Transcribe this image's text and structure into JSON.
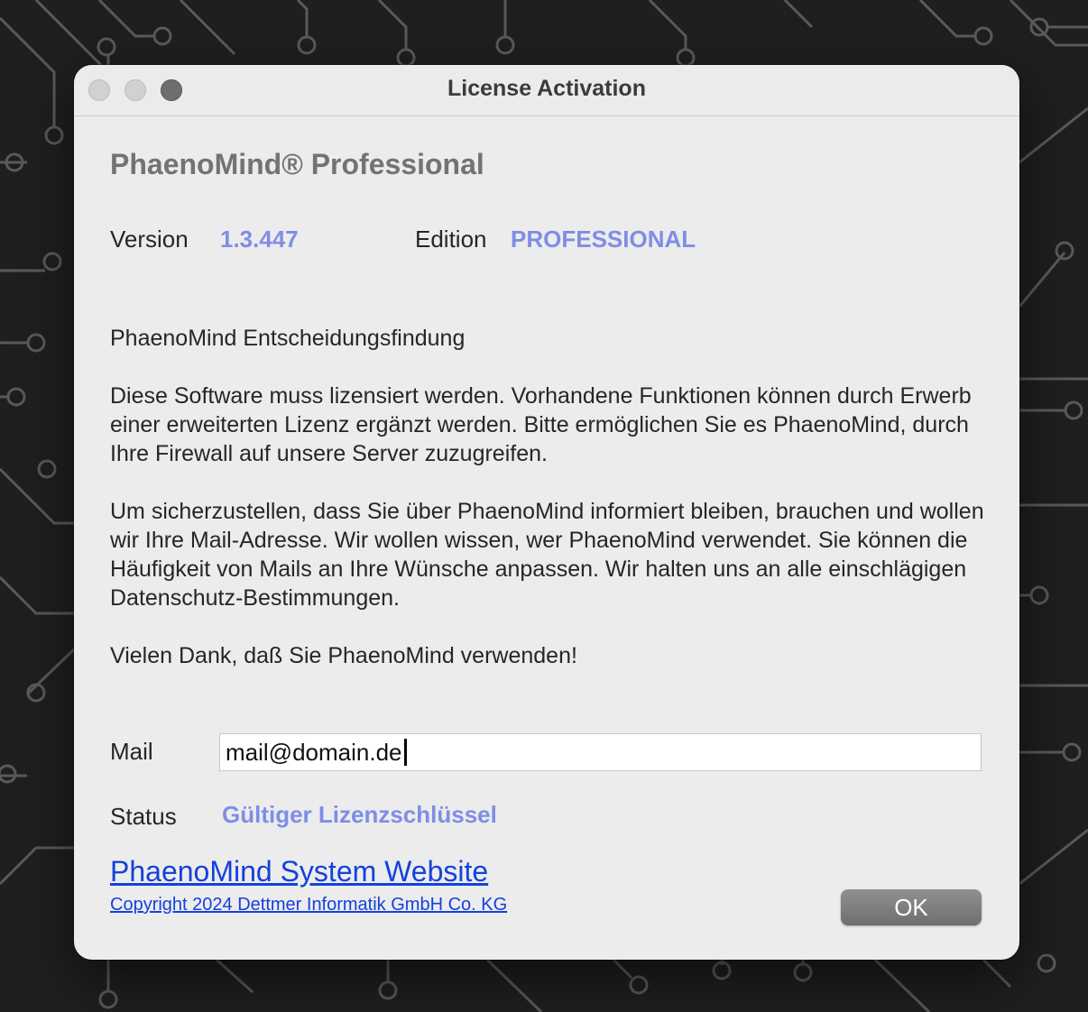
{
  "window": {
    "title": "License Activation"
  },
  "product": {
    "name": "PhaenoMind® Professional"
  },
  "info": {
    "version_label": "Version",
    "version_value": "1.3.447",
    "edition_label": "Edition",
    "edition_value": "PROFESSIONAL"
  },
  "text": {
    "heading": "PhaenoMind Entscheidungsfindung",
    "para1": "Diese Software muss lizensiert werden. Vorhandene Funktionen können durch Erwerb einer erweiterten Lizenz ergänzt werden. Bitte ermöglichen Sie  es PhaenoMind, durch Ihre Firewall auf unsere Server zuzugreifen.",
    "para2": "Um sicherzustellen, dass Sie über PhaenoMind informiert bleiben, brauchen und wollen wir Ihre Mail-Adresse. Wir wollen wissen, wer PhaenoMind verwendet. Sie können die Häufigkeit von Mails an Ihre Wünsche anpassen. Wir halten uns an alle einschlägigen Datenschutz-Bestimmungen.",
    "thanks": "Vielen Dank, daß Sie PhaenoMind verwenden!"
  },
  "form": {
    "mail_label": "Mail",
    "mail_value": "mail@domain.de",
    "status_label": "Status",
    "status_value": "Gültiger Lizenzschlüssel"
  },
  "footer": {
    "website_link": "PhaenoMind System Website",
    "copyright_link": "Copyright 2024 Dettmer Informatik GmbH  Co. KG",
    "ok_label": "OK"
  },
  "colors": {
    "accent_value": "#7e8ee6",
    "link": "#1441dd",
    "background": "#1f1f20"
  }
}
